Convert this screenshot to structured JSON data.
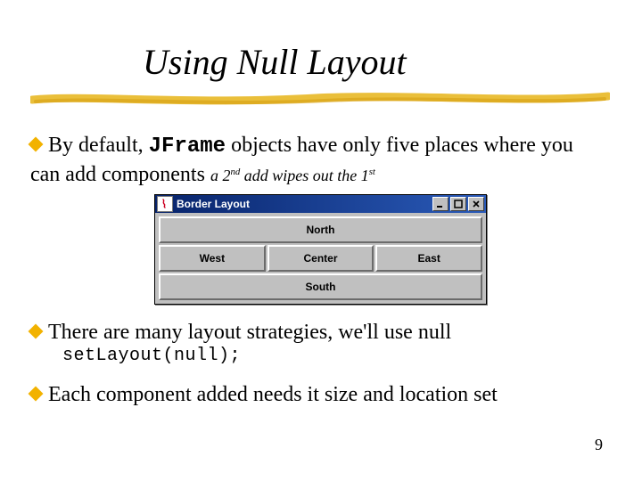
{
  "title": "Using Null Layout",
  "bullets": {
    "b1_pre": "By default, ",
    "b1_code": "JFrame",
    "b1_post": " objects have only five places where you can add components ",
    "b1_note_a": "a 2",
    "b1_note_nd": "nd",
    "b1_note_b": " add wipes out the 1",
    "b1_note_st": "st",
    "b2": "There are many layout strategies, we'll use null",
    "b2_code": "setLayout(null);",
    "b3": "Each component added needs it size and location set"
  },
  "window": {
    "title": "Border Layout",
    "north": "North",
    "west": "West",
    "center": "Center",
    "east": "East",
    "south": "South"
  },
  "page_number": "9"
}
